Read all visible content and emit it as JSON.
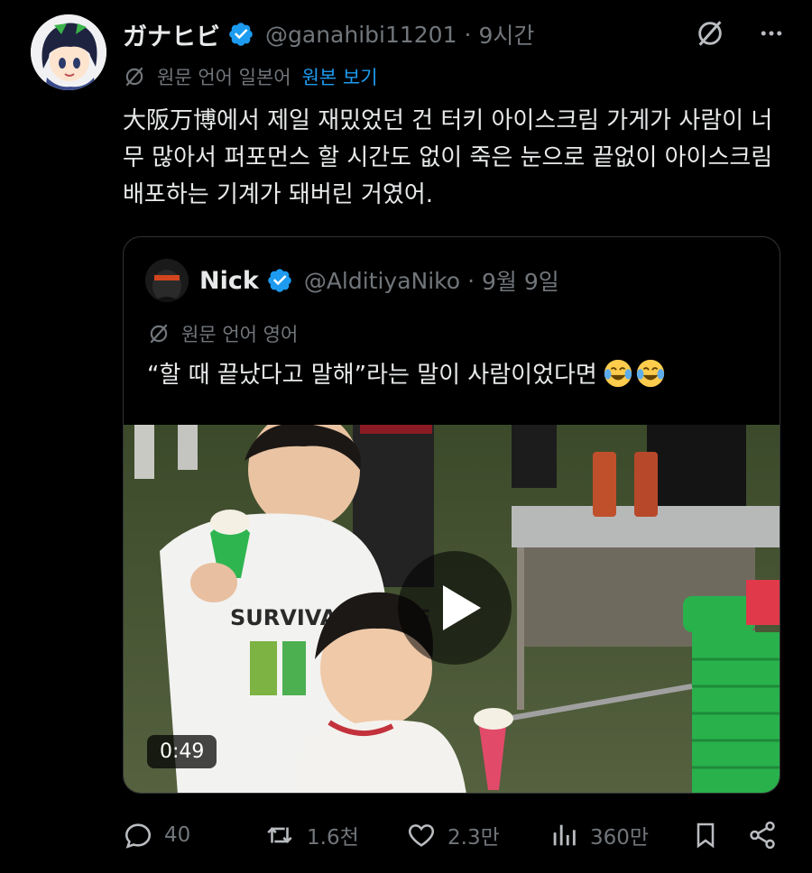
{
  "tweet": {
    "display_name": "ガナヒビ",
    "handle": "@ganahibi11201",
    "separator": "·",
    "time": "9시간",
    "translate_label": "원문 언어 일본어",
    "translate_link": "원본 보기",
    "text": "大阪万博에서 제일 재밌었던 건 터키 아이스크림 가게가 사람이 너무 많아서 퍼포먼스 할 시간도 없이 죽은 눈으로 끝없이 아이스크림 배포하는 기계가 돼버린 거였어."
  },
  "quote": {
    "display_name": "Nick",
    "handle": "@AlditiyaNiko",
    "separator": "·",
    "time": "9월 9일",
    "translate_label": "원문 언어 영어",
    "text": "“할 때 끝났다고 말해”라는 말이 사람이었다면",
    "video_duration": "0:49",
    "video_shirt_text": "SURVIVAL MODE"
  },
  "actions": {
    "replies": "40",
    "reposts": "1.6천",
    "likes": "2.3만",
    "views": "360만"
  },
  "colors": {
    "background": "#000000",
    "text": "#e7e9ea",
    "muted": "#71767b",
    "accent": "#1d9bf0",
    "border": "#2f3336"
  },
  "icons": [
    "verified-badge-icon",
    "grok-icon",
    "more-icon",
    "translate-icon",
    "laughing-emoji-icon",
    "play-icon",
    "reply-icon",
    "repost-icon",
    "like-icon",
    "views-icon",
    "bookmark-icon",
    "share-icon"
  ]
}
